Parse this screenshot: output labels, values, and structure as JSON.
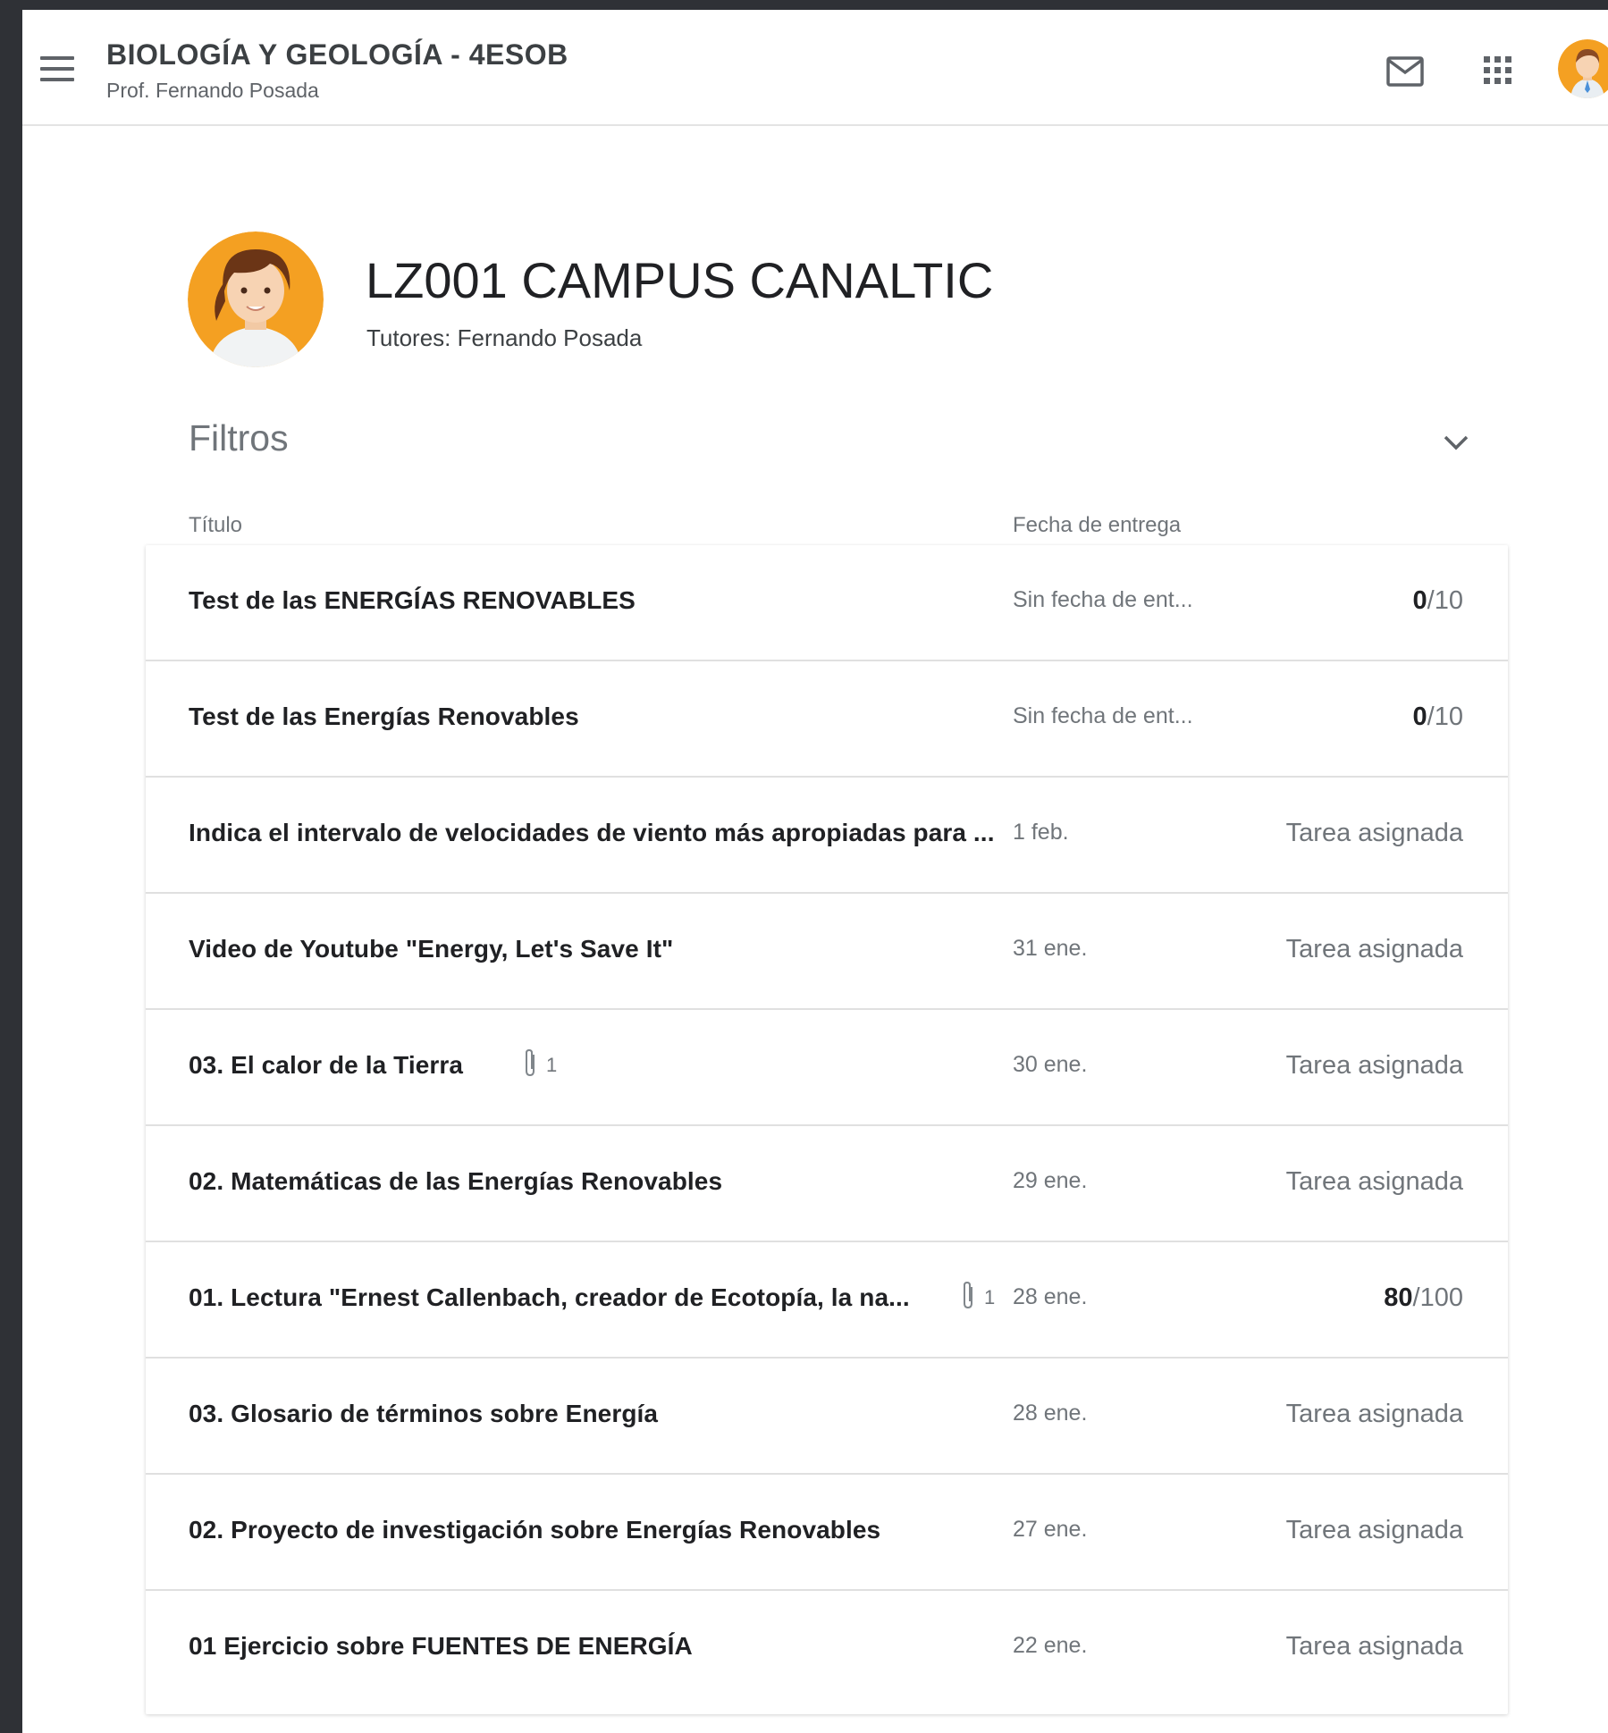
{
  "header": {
    "class_title": "BIOLOGÍA Y GEOLOGÍA - 4ESOB",
    "teacher": "Prof. Fernando Posada"
  },
  "student": {
    "name": "LZ001 CAMPUS CANALTIC",
    "tutors": "Tutores: Fernando Posada"
  },
  "filters": {
    "label": "Filtros"
  },
  "columns": {
    "title": "Título",
    "due_date": "Fecha de entrega"
  },
  "rows": [
    {
      "title": "Test de las ENERGÍAS RENOVABLES",
      "date": "Sin fecha de ent...",
      "grade_value": "0",
      "grade_total": "/10"
    },
    {
      "title": "Test de las Energías Renovables",
      "date": "Sin fecha de ent...",
      "grade_value": "0",
      "grade_total": "/10"
    },
    {
      "title": "Indica el intervalo de velocidades de viento más apropiadas para ...",
      "date": "1 feb.",
      "status": "Tarea asignada"
    },
    {
      "title": "Video de Youtube \"Energy, Let's Save It\"",
      "date": "31 ene.",
      "status": "Tarea asignada"
    },
    {
      "title": "03. El calor de la Tierra",
      "attachments": "1",
      "date": "30 ene.",
      "status": "Tarea asignada"
    },
    {
      "title": "02. Matemáticas de las Energías Renovables",
      "date": "29 ene.",
      "status": "Tarea asignada"
    },
    {
      "title": "01. Lectura \"Ernest Callenbach, creador de Ecotopía, la na...",
      "attachments": "1",
      "date": "28 ene.",
      "grade_value": "80",
      "grade_total": "/100"
    },
    {
      "title": "03. Glosario de términos sobre Energía",
      "date": "28 ene.",
      "status": "Tarea asignada"
    },
    {
      "title": "02. Proyecto de investigación sobre Energías Renovables",
      "date": "27 ene.",
      "status": "Tarea asignada"
    },
    {
      "title": "01 Ejercicio sobre FUENTES DE ENERGÍA",
      "date": "22 ene.",
      "status": "Tarea asignada"
    }
  ],
  "colors": {
    "background_frame": "#2f3136",
    "text_primary": "#202124",
    "text_secondary": "#70757a",
    "avatar_orange": "#f4a022"
  }
}
